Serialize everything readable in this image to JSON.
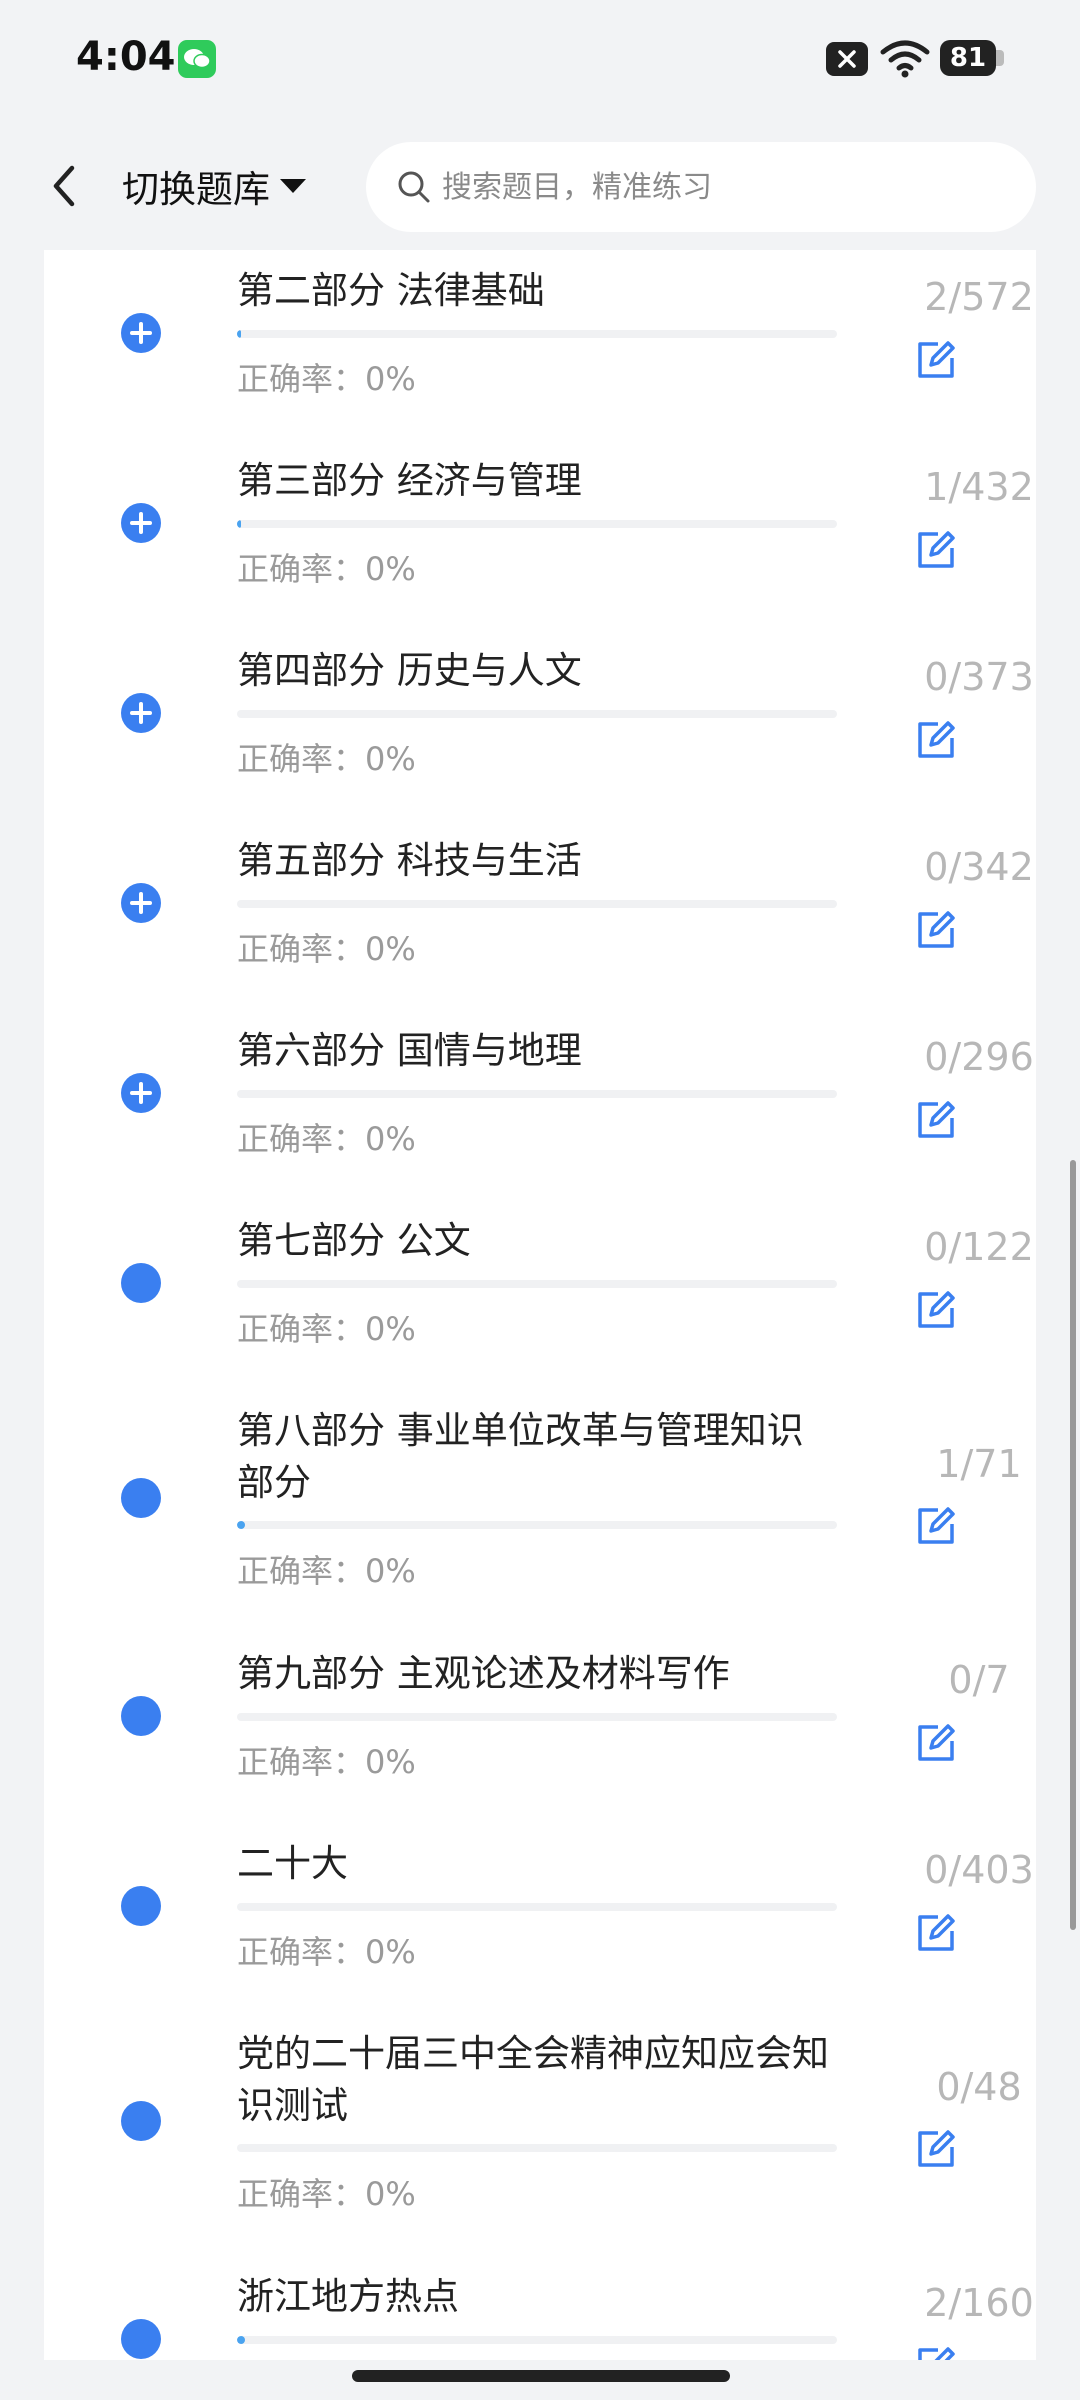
{
  "status": {
    "time": "4:04",
    "battery": "81"
  },
  "header": {
    "switch_label": "切换题库",
    "search_placeholder": "搜索题目，精准练习"
  },
  "items": [
    {
      "title": "第二部分 法律基础",
      "accuracy": "正确率：0%",
      "count": "2/572",
      "progress": 0.003,
      "icon": "plus"
    },
    {
      "title": "第三部分 经济与管理",
      "accuracy": "正确率：0%",
      "count": "1/432",
      "progress": 0.002,
      "icon": "plus"
    },
    {
      "title": "第四部分 历史与人文",
      "accuracy": "正确率：0%",
      "count": "0/373",
      "progress": 0,
      "icon": "plus"
    },
    {
      "title": "第五部分 科技与生活",
      "accuracy": "正确率：0%",
      "count": "0/342",
      "progress": 0,
      "icon": "plus"
    },
    {
      "title": "第六部分 国情与地理",
      "accuracy": "正确率：0%",
      "count": "0/296",
      "progress": 0,
      "icon": "plus"
    },
    {
      "title": "第七部分 公文",
      "accuracy": "正确率：0%",
      "count": "0/122",
      "progress": 0,
      "icon": "dot"
    },
    {
      "title": "第八部分 事业单位改革与管理知识部分",
      "accuracy": "正确率：0%",
      "count": "1/71",
      "progress": 0.014,
      "icon": "dot"
    },
    {
      "title": "第九部分 主观论述及材料写作",
      "accuracy": "正确率：0%",
      "count": "0/7",
      "progress": 0,
      "icon": "dot"
    },
    {
      "title": "二十大",
      "accuracy": "正确率：0%",
      "count": "0/403",
      "progress": 0,
      "icon": "dot"
    },
    {
      "title": "党的二十届三中全会精神应知应会知识测试",
      "accuracy": "正确率：0%",
      "count": "0/48",
      "progress": 0,
      "icon": "dot"
    },
    {
      "title": "浙江地方热点",
      "accuracy": "",
      "count": "2/160",
      "progress": 0.0125,
      "icon": "dot"
    }
  ]
}
